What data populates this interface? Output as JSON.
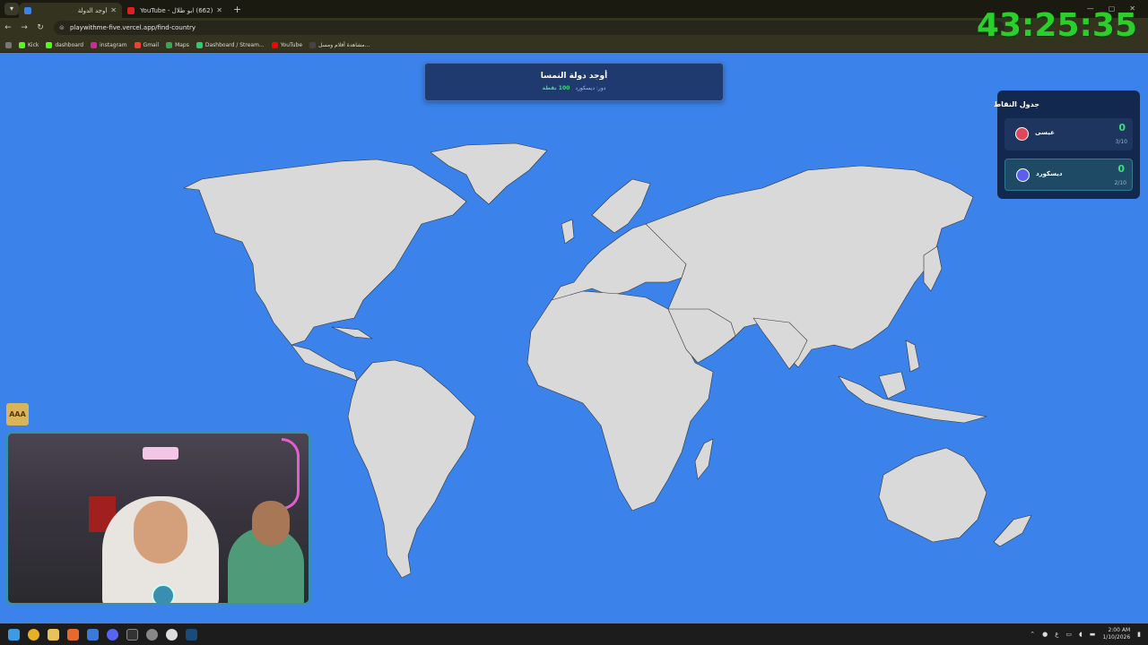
{
  "browser": {
    "tabs": [
      {
        "title": "أوجد الدولة",
        "active": true
      },
      {
        "title": "(662) ابو طلال - YouTube",
        "active": false
      }
    ],
    "new_tab": "+",
    "url": "playwithme-five.vercel.app/find-country",
    "bookmarks": [
      "Kick",
      "dashboard",
      "instagram",
      "Gmail",
      "Maps",
      "Dashboard / Stream...",
      "YouTube",
      "مشاهدة أفلام ومسل..."
    ]
  },
  "timer": "43:25:35",
  "game": {
    "title": "أوجد دولة النمسا",
    "turn_label": "دور: ديسكورد",
    "points_label": "100 نقطة"
  },
  "scoreboard": {
    "title": "جدول النقاط",
    "players": [
      {
        "name": "عيسى",
        "score": "0",
        "progress": "3/10",
        "color": "#e0475a"
      },
      {
        "name": "ديسكورد",
        "score": "0",
        "progress": "2/10",
        "color": "#5b5fef"
      }
    ]
  },
  "badge": "AAA",
  "taskbar": {
    "time": "2:00 AM",
    "date": "1/10/2026",
    "lang": "ع"
  }
}
